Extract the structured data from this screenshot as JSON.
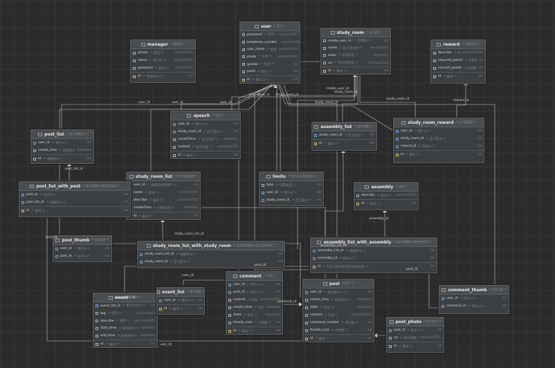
{
  "tables": [
    {
      "id": "user",
      "name": "user",
      "comment": "/* 用户 */",
      "columns": [
        {
          "name": "password",
          "comment": "/* 密码 */",
          "type": "varchar(50)"
        },
        {
          "name": "telephone_number",
          "comment": "/* 电话号码 */",
          "type": "varchar(20)"
        },
        {
          "name": "user_name",
          "comment": "/* 姓名 */",
          "type": "varchar(20)"
        },
        {
          "name": "photo",
          "comment": "/* 头像 */",
          "type": "varchar(255)"
        },
        {
          "name": "gender",
          "comment": "/* 性别 */",
          "type": "int"
        },
        {
          "name": "point",
          "comment": "/* 积分 */",
          "type": "int"
        },
        {
          "name": "id",
          "comment": "/* 用户id */",
          "type": "int",
          "pk": true
        }
      ]
    },
    {
      "id": "study_room",
      "name": "study_room",
      "comment": "/* 自习室 */",
      "columns": [
        {
          "name": "create_user_id",
          "comment": "/* 创建者id */",
          "type": "int"
        },
        {
          "name": "name",
          "comment": "/* 自习室名称 */",
          "type": "varchar(50)"
        },
        {
          "name": "state",
          "comment": "/* 房间状态 */",
          "type": "tinyint(1)"
        },
        {
          "name": "url",
          "comment": "/* 自习室链接 */",
          "type": "varchar(255)"
        },
        {
          "name": "id",
          "comment": "/* 编号 */",
          "type": "int",
          "pk": true
        }
      ]
    },
    {
      "id": "manager",
      "name": "manager",
      "comment": "/* 管理员 */",
      "columns": [
        {
          "name": "phone",
          "comment": "/* 电话 */",
          "type": "varchar(20)"
        },
        {
          "name": "name",
          "comment": "/* 用户名 */",
          "type": "varchar(20)"
        },
        {
          "name": "password",
          "comment": "/* 密码 */",
          "type": "varchar(50)"
        },
        {
          "name": "id",
          "comment": "/* 管理员id */",
          "type": "int",
          "pk": true
        }
      ]
    },
    {
      "id": "reward",
      "name": "reward",
      "comment": "/* 奖励规则 */",
      "columns": [
        {
          "name": "describe",
          "comment": "/* 奖励描述 */",
          "type": "varchar(255)"
        },
        {
          "name": "required_points",
          "comment": "/* 所需积分 */",
          "type": "int"
        },
        {
          "name": "convert_points",
          "comment": "/* 兑换积分 */",
          "type": "int"
        },
        {
          "name": "id",
          "comment": "/* 编号 */",
          "type": "int",
          "pk": true
        }
      ]
    },
    {
      "id": "speech",
      "name": "speech",
      "comment": "/* 发言 */",
      "columns": [
        {
          "name": "user_id",
          "comment": "/* 用户id */",
          "type": "int",
          "fk": true
        },
        {
          "name": "study_room_id",
          "comment": "/* 自习室id */",
          "type": "int",
          "fk": true
        },
        {
          "name": "createTime",
          "comment": "/* 发言时间 */",
          "type": "datetime"
        },
        {
          "name": "content",
          "comment": "/* 发言内容 */",
          "type": "varchar(255)"
        },
        {
          "name": "id",
          "comment": "/* 编号 */",
          "type": "int",
          "pk": true
        }
      ]
    },
    {
      "id": "post_list",
      "name": "post_list",
      "comment": "/* 帖子收藏夹 */",
      "columns": [
        {
          "name": "user_id",
          "comment": "/* 用户id */",
          "type": "int",
          "fk": true
        },
        {
          "name": "create_time",
          "comment": "/* 创建时间 */",
          "type": "datetime"
        },
        {
          "name": "id",
          "comment": "/* 收藏夹id */",
          "type": "int",
          "pk": true
        }
      ]
    },
    {
      "id": "assembly_list",
      "name": "assembly_list",
      "comment": "/* 组件收藏夹 */",
      "columns": [
        {
          "name": "study_room_id",
          "comment": "/* 自习室id */",
          "type": "int",
          "fk": true
        },
        {
          "name": "id",
          "comment": "/* 编号 */",
          "type": "int",
          "pk": true
        }
      ]
    },
    {
      "id": "study_room_reward",
      "name": "study_room_reward",
      "comment": "/* 自习室奖励 */",
      "columns": [
        {
          "name": "user_id",
          "comment": "/* 用户id */",
          "type": "int",
          "fk": true
        },
        {
          "name": "study_room_id",
          "comment": "/* 自习室id */",
          "type": "int",
          "fk": true
        },
        {
          "name": "reward_id",
          "comment": "/* 奖励id */",
          "type": "int",
          "fk": true
        },
        {
          "name": "id",
          "comment": "/* 编号 */",
          "type": "int",
          "pk": true
        }
      ]
    },
    {
      "id": "study_room_list",
      "name": "study_room_list",
      "comment": "/* 自习室收藏夹 */",
      "columns": [
        {
          "name": "user_id",
          "comment": "/* 收藏夹所属用户 */",
          "type": "int",
          "fk": true
        },
        {
          "name": "name",
          "comment": "/* 名称 */",
          "type": "varchar(20)"
        },
        {
          "name": "describe",
          "comment": "/* 描述 */",
          "type": "varchar(255)"
        },
        {
          "name": "createTime",
          "comment": "/* 创建时间 */",
          "type": "datetime"
        },
        {
          "name": "id",
          "comment": "/* 编号 */",
          "type": "int",
          "pk": true
        }
      ]
    },
    {
      "id": "limits",
      "name": "limits",
      "comment": "/* 用户自习室权限表 */",
      "columns": [
        {
          "name": "type",
          "comment": "/* 权限类型 */",
          "type": "int"
        },
        {
          "name": "user_id",
          "comment": "/* 用户id */",
          "type": "int",
          "fk": true
        },
        {
          "name": "study_room_id",
          "comment": "/* 自习室id */",
          "type": "int",
          "fk": true
        }
      ]
    },
    {
      "id": "post_list_with_post",
      "name": "post_list_with_post",
      "comment": "/* 帖子收藏夹与帖子关系表 */",
      "columns": [
        {
          "name": "post_id",
          "comment": "/* 帖子id */",
          "type": "int",
          "fk": true
        },
        {
          "name": "post_list_id",
          "comment": "/* 收藏夹id */",
          "type": "int",
          "fk": true
        },
        {
          "name": "id",
          "comment": "/* 编号 */",
          "type": "int",
          "pk": true
        }
      ]
    },
    {
      "id": "assembly",
      "name": "assembly",
      "comment": "/* 组件 */",
      "columns": [
        {
          "name": "describe",
          "comment": "/* 描述 */",
          "type": "varchar(255)"
        },
        {
          "name": "id",
          "comment": "/* 编号 */",
          "type": "int",
          "pk": true
        }
      ]
    },
    {
      "id": "post_thumb",
      "name": "post_thumb",
      "comment": "/* 帖子点赞 */",
      "columns": [
        {
          "name": "user_id",
          "comment": "/* 用户id */",
          "type": "int",
          "fk": true
        },
        {
          "name": "post_id",
          "comment": "/* 帖子id */",
          "type": "int",
          "fk": true
        }
      ]
    },
    {
      "id": "study_room_list_with_study_room",
      "name": "study_room_list_with_study_room",
      "comment": "/* 自习室收藏夹与自习室关系表 */",
      "columns": [
        {
          "name": "study_room_list_id",
          "comment": "/* 收藏夹id */",
          "type": "int",
          "fk": true
        },
        {
          "name": "study_room_id",
          "comment": "/* 自习室id */",
          "type": "int",
          "fk": true
        }
      ]
    },
    {
      "id": "assembly_list_with_assembly",
      "name": "assembly_list_with_assembly",
      "comment": "/* 组件收藏夹与组件关系表 */",
      "columns": [
        {
          "name": "assembly_list_id",
          "comment": "/* 收藏夹id */",
          "type": "int",
          "fk": true
        },
        {
          "name": "assembly_id",
          "comment": "/* 组件id */",
          "type": "int",
          "fk": true
        },
        {
          "name": "id",
          "comment": "/* 在自习室中的组件布局信息 */",
          "type": "int",
          "pk": true
        }
      ]
    },
    {
      "id": "comment",
      "name": "comment",
      "comment": "/* 评论 */",
      "columns": [
        {
          "name": "user_id",
          "comment": "/* 用户id */",
          "type": "int",
          "fk": true
        },
        {
          "name": "post_id",
          "comment": "/* 帖子id */",
          "type": "int",
          "fk": true
        },
        {
          "name": "content",
          "comment": "/* 内容 */",
          "type": "varchar(255)"
        },
        {
          "name": "create_time",
          "comment": "/* 评论时间 */",
          "type": "datetime"
        },
        {
          "name": "state",
          "comment": "/* 状态 */",
          "type": "tinyint(1)"
        },
        {
          "name": "thumb_num",
          "comment": "/* 点赞数 */",
          "type": "int"
        },
        {
          "name": "id",
          "comment": "/* 编号 */",
          "type": "int",
          "pk": true
        }
      ]
    },
    {
      "id": "event",
      "name": "event",
      "comment": "/* 事件 */",
      "columns": [
        {
          "name": "event_list_id",
          "comment": "/* 事件清单id */",
          "type": "int",
          "fk": true
        },
        {
          "name": "tag",
          "comment": "/* 标签 */",
          "type": "varchar(20)"
        },
        {
          "name": "describe",
          "comment": "/* 描述 */",
          "type": "varchar(255)"
        },
        {
          "name": "start_time",
          "comment": "/* 开始时间 */",
          "type": "datetime"
        },
        {
          "name": "end_time",
          "comment": "/* 结束时间 */",
          "type": "datetime"
        },
        {
          "name": "id",
          "comment": "/* 编号 */",
          "type": "int",
          "pk": true
        }
      ]
    },
    {
      "id": "event_list",
      "name": "event_list",
      "comment": "/* 事件清单 */",
      "columns": [
        {
          "name": "user_id",
          "comment": "/* 用户id */",
          "type": "int",
          "fk": true
        },
        {
          "name": "id",
          "comment": "/* 编号 */",
          "type": "int",
          "pk": true
        }
      ]
    },
    {
      "id": "post",
      "name": "post",
      "comment": "/* 帖子 */",
      "columns": [
        {
          "name": "user_id",
          "comment": "/* 发帖用户id */",
          "type": "int",
          "fk": true
        },
        {
          "name": "create_time",
          "comment": "/* 发帖时间 */",
          "type": "datetime"
        },
        {
          "name": "state",
          "comment": "/* 状态 */",
          "type": "tinyint(1)"
        },
        {
          "name": "content",
          "comment": "/* 内容 */",
          "type": "varchar(255)"
        },
        {
          "name": "comment_number",
          "comment": "/* 评论数 */",
          "type": "int"
        },
        {
          "name": "thumb_num",
          "comment": "/* 点赞数 */",
          "type": "int"
        },
        {
          "name": "id",
          "comment": "/* 编号 */",
          "type": "int",
          "pk": true
        }
      ]
    },
    {
      "id": "comment_thumb",
      "name": "comment_thumb",
      "comment": "/* 评论点赞 */",
      "columns": [
        {
          "name": "user_id",
          "comment": "/* 用户id */",
          "type": "int",
          "fk": true
        },
        {
          "name": "comment_id",
          "comment": "/* 评论id */",
          "type": "int",
          "fk": true
        }
      ]
    },
    {
      "id": "post_photo",
      "name": "post_photo",
      "comment": "/* 帖子图片 */",
      "columns": [
        {
          "name": "post_id",
          "comment": "/* 帖子id */",
          "type": "int",
          "fk": true
        },
        {
          "name": "url",
          "comment": "/* 图片链接 */",
          "type": "varchar(255)"
        },
        {
          "name": "id",
          "comment": "/* 编号 */",
          "type": "int",
          "pk": true
        }
      ]
    }
  ],
  "edge_labels": [
    {
      "id": "l1",
      "text": "user_id"
    },
    {
      "id": "l2",
      "text": "user_id"
    },
    {
      "id": "l3",
      "text": "user_id"
    },
    {
      "id": "l4",
      "text": "user_id"
    },
    {
      "id": "l5",
      "text": "user_id"
    },
    {
      "id": "l6",
      "text": "user_id"
    },
    {
      "id": "l7",
      "text": "create_user_id"
    },
    {
      "id": "l8",
      "text": "study_room_id"
    },
    {
      "id": "l9",
      "text": "study_room_id"
    },
    {
      "id": "l10",
      "text": "study_room_id"
    },
    {
      "id": "l11",
      "text": "study_room_id"
    },
    {
      "id": "l12",
      "text": "reward_id"
    },
    {
      "id": "l13",
      "text": "post_list_id"
    },
    {
      "id": "l14",
      "text": "post_id"
    },
    {
      "id": "l15",
      "text": "study_room_list_id"
    },
    {
      "id": "l16",
      "text": "assembly_id"
    },
    {
      "id": "l17",
      "text": "assembly_list_id"
    },
    {
      "id": "l18",
      "text": "post_id"
    },
    {
      "id": "l19",
      "text": "event_list_id"
    },
    {
      "id": "l20",
      "text": "comment_id"
    },
    {
      "id": "l21",
      "text": "post_id"
    },
    {
      "id": "l22",
      "text": "post_id"
    }
  ]
}
